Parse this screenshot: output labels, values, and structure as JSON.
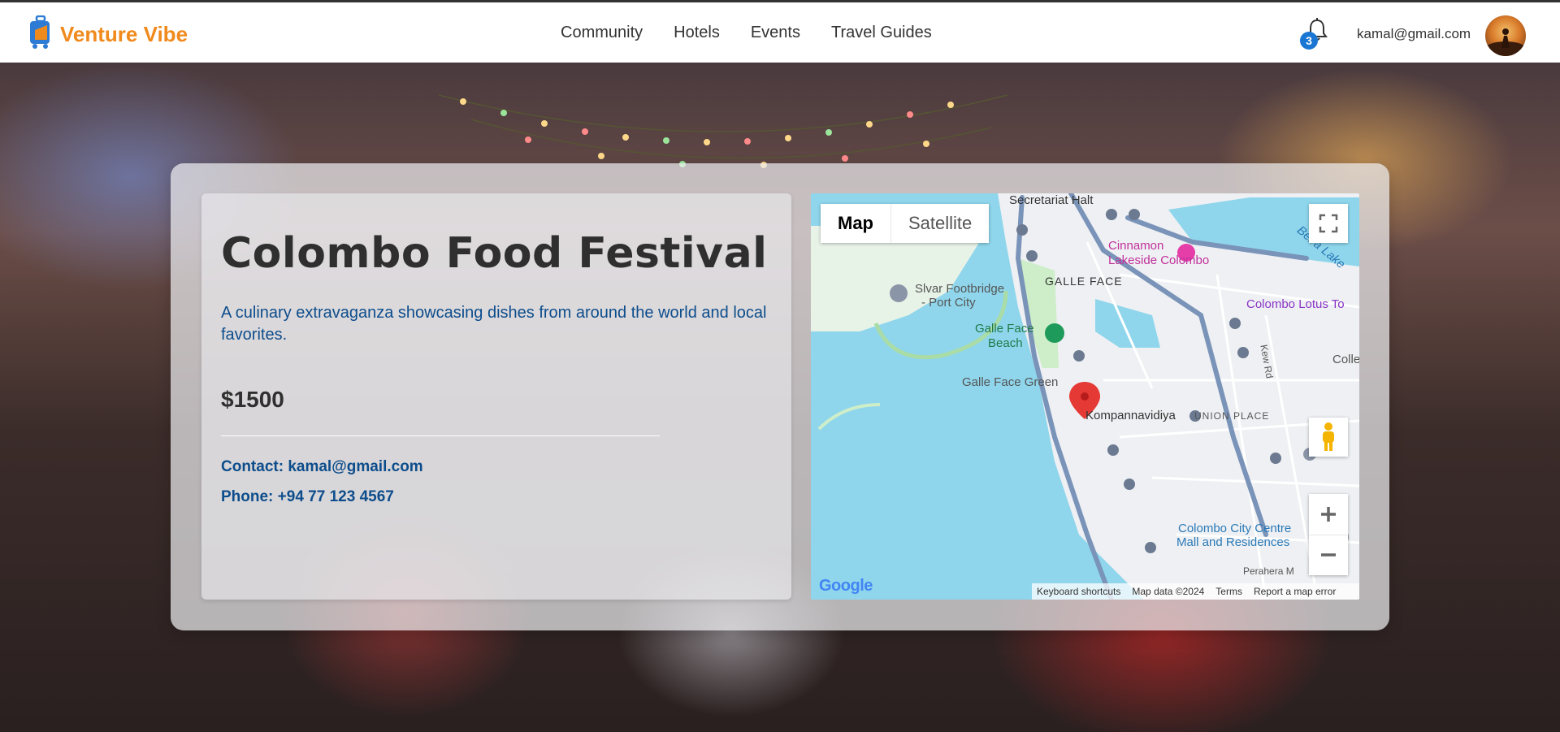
{
  "brand": {
    "name": "Venture Vibe"
  },
  "nav": {
    "items": [
      "Community",
      "Hotels",
      "Events",
      "Travel Guides"
    ]
  },
  "header": {
    "notification_count": "3",
    "user_email": "kamal@gmail.com"
  },
  "event": {
    "title": "Colombo Food Festival",
    "description": "A culinary extravaganza showcasing dishes from around the world and local favorites.",
    "price": "$1500",
    "contact": "Contact: kamal@gmail.com",
    "phone": "Phone: +94 77 123 4567"
  },
  "map": {
    "type_map": "Map",
    "type_satellite": "Satellite",
    "google_logo": "Google",
    "footer": {
      "shortcuts": "Keyboard shortcuts",
      "data": "Map data ©2024",
      "terms": "Terms",
      "report": "Report a map error"
    },
    "labels": {
      "secretariat": "Secretariat Halt",
      "cinnamon1": "Cinnamon",
      "cinnamon2": "Lakeside Colombo",
      "beira": "Beira Lake",
      "silvar1": "Slvar Footbridge",
      "silvar2": "- Port City",
      "gallefacearea": "GALLE FACE",
      "lotus": "Colombo Lotus To",
      "gfbeach1": "Galle Face",
      "gfbeach2": "Beach",
      "gfgreen": "Galle Face Green",
      "kew": "Kew Rd",
      "colle": "Colle",
      "kompanna": "Kompannavidiya",
      "union": "UNION PLACE",
      "ccc1": "Colombo City Centre",
      "ccc2": "Mall and Residences",
      "perahera": "Perahera M"
    }
  },
  "colors": {
    "brand": "#f08a1c",
    "link": "#0d4d8c",
    "badge": "#1976d2",
    "marker": "#e53935"
  }
}
